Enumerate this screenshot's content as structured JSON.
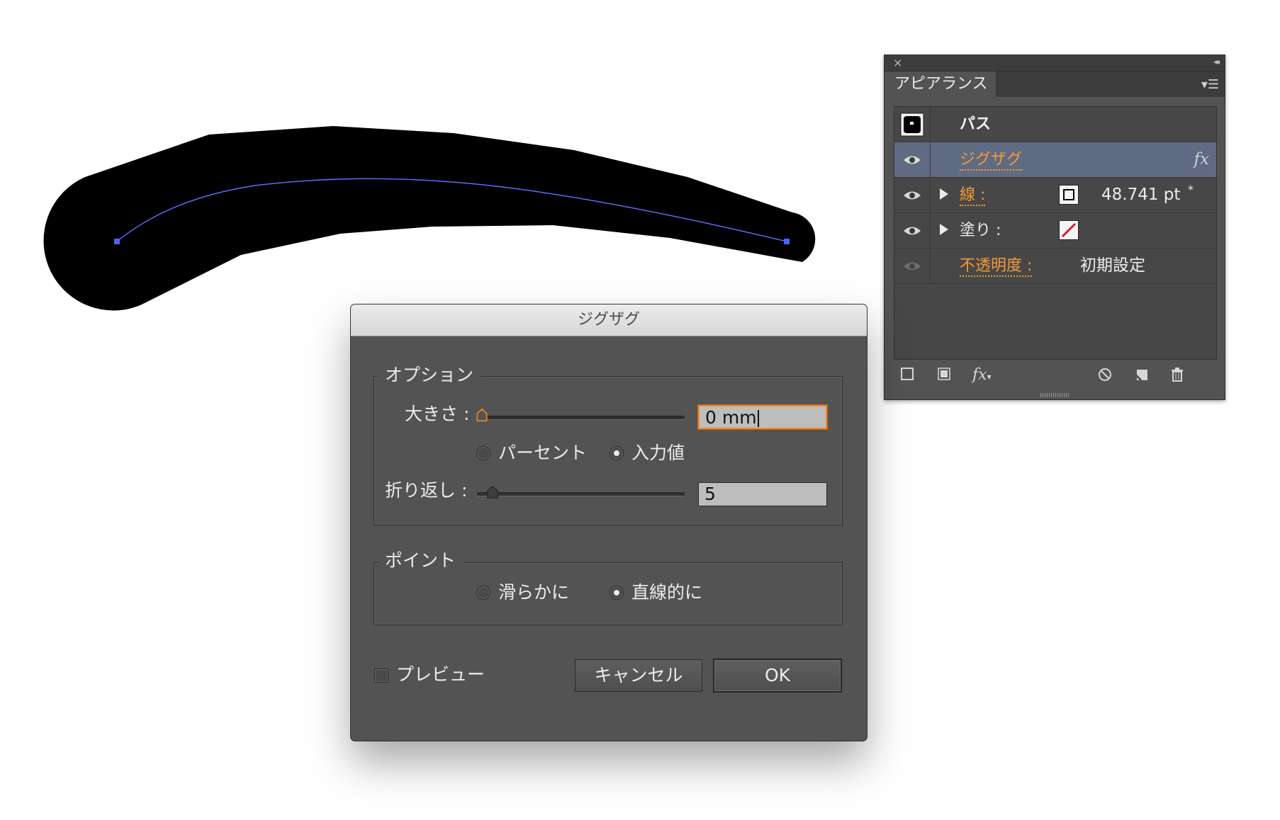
{
  "appearance_panel": {
    "close_icon": "close-icon",
    "collapse_icon": "collapse-icon",
    "tab_label": "アピアランス",
    "menu_icon": "panel-menu-icon",
    "object_label": "パス",
    "rows": {
      "effect": {
        "label": "ジグザグ",
        "fx": "fx"
      },
      "stroke": {
        "label": "線 :",
        "value": "48.741 pt",
        "asterisk": "*"
      },
      "fill": {
        "label": "塗り :"
      },
      "opacity": {
        "label": "不透明度 :",
        "value": "初期設定"
      }
    },
    "accent_color": "#f39a3a",
    "selected_row_color": "#5f6b82"
  },
  "dialog": {
    "title": "ジグザグ",
    "options_group": {
      "label": "オプション",
      "size_label": "大きさ :",
      "size_value": "0 mm",
      "size_slider": 0,
      "percent_label": "パーセント",
      "absolute_label": "入力値",
      "absolute_selected": true,
      "ridges_label": "折り返し :",
      "ridges_value": "5",
      "ridges_slider": 0.05
    },
    "points_group": {
      "label": "ポイント",
      "smooth_label": "滑らかに",
      "corner_label": "直線的に",
      "corner_selected": true
    },
    "preview_label": "プレビュー",
    "preview_checked": false,
    "cancel_label": "キャンセル",
    "ok_label": "OK"
  }
}
